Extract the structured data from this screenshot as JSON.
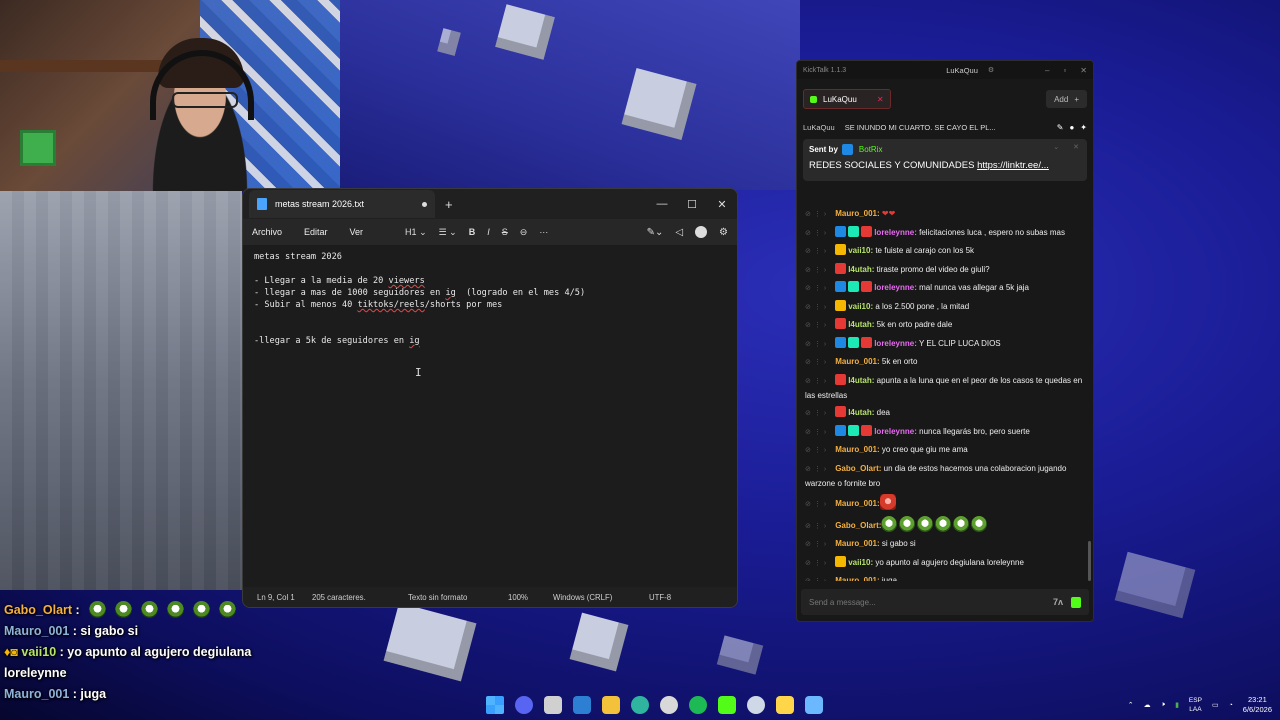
{
  "notepad": {
    "tab_title": "metas stream 2026.txt",
    "menu": [
      "Archivo",
      "Editar",
      "Ver"
    ],
    "heading_label": "H1",
    "lines": [
      "metas stream 2026",
      "",
      "- Llegar a la media de 20 viewers",
      "- llegar a mas de 1000 seguidores en ig  (logrado en el mes 4/5)",
      "- Subir al menos 40 tiktoks/reels/shorts por mes",
      "",
      "",
      "-llegar a 5k de seguidores en ig"
    ],
    "status": {
      "position": "Ln 9, Col 1",
      "chars": "205 caracteres.",
      "format": "Texto sin formato",
      "zoom": "100%",
      "line_endings": "Windows (CRLF)",
      "encoding": "UTF-8"
    }
  },
  "kicktalk": {
    "app_title": "KickTalk 1.1.3",
    "window_user": "LuKaQuu",
    "tab_label": "LuKaQuu",
    "add_label": "Add",
    "streamer": "LuKaQuu",
    "stream_title": "SE INUNDO MI CUARTO. SE CAYO EL PL...",
    "pinned": {
      "sent_by": "Sent by",
      "bot": "BotRix",
      "message": "REDES SOCIALES Y COMUNIDADES",
      "link": "https://linktr.ee/..."
    },
    "messages": [
      {
        "user": "Mauro_001:",
        "text": "",
        "color": "#f5b041",
        "badges": [],
        "emotes": 0,
        "heart": true
      },
      {
        "user": "loreleynne:",
        "text": "felicitaciones luca , espero no subas mas",
        "color": "#e86cf2",
        "badges": [
          "#1e88e5",
          "#1de9b6",
          "#e53935"
        ],
        "emotes": 0
      },
      {
        "user": "vaii10:",
        "text": "te fuiste al carajo con los 5k",
        "color": "#b8e36a",
        "badges": [
          "#f5b800"
        ],
        "emotes": 0
      },
      {
        "user": "l4utah:",
        "text": "tiraste promo del video de giuli?",
        "color": "#b8e36a",
        "badges": [
          "#e53935"
        ],
        "emotes": 0
      },
      {
        "user": "loreleynne:",
        "text": "mal nunca vas allegar a 5k jaja",
        "color": "#e86cf2",
        "badges": [
          "#1e88e5",
          "#1de9b6",
          "#e53935"
        ],
        "emotes": 0
      },
      {
        "user": "vaii10:",
        "text": "a los 2.500 pone , la mitad",
        "color": "#b8e36a",
        "badges": [
          "#f5b800"
        ],
        "emotes": 0
      },
      {
        "user": "l4utah:",
        "text": "5k en orto padre dale",
        "color": "#b8e36a",
        "badges": [
          "#e53935"
        ],
        "emotes": 0
      },
      {
        "user": "loreleynne:",
        "text": "Y EL CLIP LUCA DIOS",
        "color": "#e86cf2",
        "badges": [
          "#1e88e5",
          "#1de9b6",
          "#e53935"
        ],
        "emotes": 0
      },
      {
        "user": "Mauro_001:",
        "text": "5k en orto",
        "color": "#f5b041",
        "badges": [],
        "emotes": 0
      },
      {
        "user": "l4utah:",
        "text": "apunta a la luna que en el peor de los casos te quedas en las estrellas",
        "color": "#b8e36a",
        "badges": [
          "#e53935"
        ],
        "emotes": 0
      },
      {
        "user": "l4utah:",
        "text": "dea",
        "color": "#b8e36a",
        "badges": [
          "#e53935"
        ],
        "emotes": 0
      },
      {
        "user": "loreleynne:",
        "text": "nunca llegarás bro, pero suerte",
        "color": "#e86cf2",
        "badges": [
          "#1e88e5",
          "#1de9b6",
          "#e53935"
        ],
        "emotes": 0
      },
      {
        "user": "Mauro_001:",
        "text": "yo creo que giu me ama",
        "color": "#f5b041",
        "badges": [],
        "emotes": 0
      },
      {
        "user": "Gabo_Olart:",
        "text": "un dia de estos hacemos una colaboracion jugando warzone o fornite bro",
        "color": "#f5b041",
        "badges": [],
        "emotes": 0
      },
      {
        "user": "Mauro_001:",
        "text": "",
        "color": "#f5b041",
        "badges": [],
        "emotes": 0,
        "redemote": true
      },
      {
        "user": "Gabo_Olart:",
        "text": "",
        "color": "#f5b041",
        "badges": [],
        "emotes": 6
      },
      {
        "user": "Mauro_001:",
        "text": "si gabo si",
        "color": "#f5b041",
        "badges": [],
        "emotes": 0
      },
      {
        "user": "vaii10:",
        "text": "yo apunto al agujero degiulana loreleynne",
        "color": "#b8e36a",
        "badges": [
          "#f5b800"
        ],
        "emotes": 0
      },
      {
        "user": "Mauro_001:",
        "text": "juga",
        "color": "#f5b041",
        "badges": [],
        "emotes": 0
      }
    ],
    "input_placeholder": "Send a message..."
  },
  "overlay": {
    "lines": [
      {
        "user": "Gabo_Olart",
        "sep": " :",
        "text": "",
        "emotes": 6,
        "class": "ov-user-gold"
      },
      {
        "user": "Mauro_001",
        "sep": " :",
        "text": " si gabo si",
        "emotes": 0,
        "class": "ov-user-blue"
      },
      {
        "user": "vaii10",
        "sep": " :",
        "text": " yo apunto al agujero degiulana",
        "emotes": 0,
        "class": "ov-user-green",
        "badges": true
      },
      {
        "user": "",
        "sep": "",
        "text": "loreleynne",
        "emotes": 0,
        "class": ""
      },
      {
        "user": "Mauro_001",
        "sep": " :",
        "text": " juga",
        "emotes": 0,
        "class": "ov-user-blue"
      }
    ]
  },
  "taskbar": {
    "icons": [
      "windows-icon",
      "discord-icon",
      "task-view-icon",
      "store-icon",
      "file-explorer-icon",
      "edge-icon",
      "chrome-icon",
      "spotify-icon",
      "kick-icon",
      "steam-icon",
      "kicktalk-icon",
      "notepad-icon"
    ],
    "icon_colors": [
      "#3aa0ff",
      "#5865f2",
      "#d0d0d0",
      "#2d7fd3",
      "#f3c13a",
      "#2fb4a0",
      "#d8d8d8",
      "#1db954",
      "#53fc18",
      "#cfd8e6",
      "#ffd54a",
      "#6bb8ff"
    ],
    "lang_top": "ESP",
    "lang_bottom": "LAA",
    "time": "23:21",
    "date": "6/6/2026"
  }
}
